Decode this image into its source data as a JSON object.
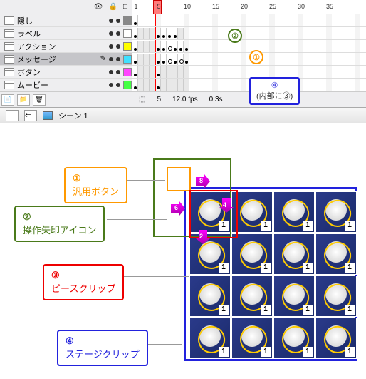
{
  "timeline": {
    "ruler": [
      1,
      5,
      10,
      15,
      20,
      25,
      30,
      35
    ],
    "current_frame": 5,
    "layers": [
      {
        "name": "隠し",
        "color": "#888888"
      },
      {
        "name": "ラベル",
        "color": "#ffffff"
      },
      {
        "name": "アクション",
        "color": "#ffff00"
      },
      {
        "name": "メッセージ",
        "color": "#40e0ff",
        "active": true
      },
      {
        "name": "ボタン",
        "color": "#ff40ff"
      },
      {
        "name": "ムービー",
        "color": "#40ff40"
      }
    ],
    "footer": {
      "frame": "5",
      "fps": "12.0 fps",
      "time": "0.3s"
    }
  },
  "scene": {
    "label": "シーン 1"
  },
  "annotations": {
    "tl_2": "②",
    "tl_1": "①",
    "tl_4": "④",
    "tl_4_inner": "(内部に③)",
    "c1_num": "①",
    "c1_text": "汎用ボタン",
    "c2_num": "②",
    "c2_text": "操作矢印アイコン",
    "c3_num": "③",
    "c3_text": "ピースクリップ",
    "c4_num": "④",
    "c4_text": "ステージクリップ"
  },
  "arrows": {
    "a": "8",
    "b": "6",
    "c": "4",
    "d": "2"
  },
  "piece_badge": "1"
}
